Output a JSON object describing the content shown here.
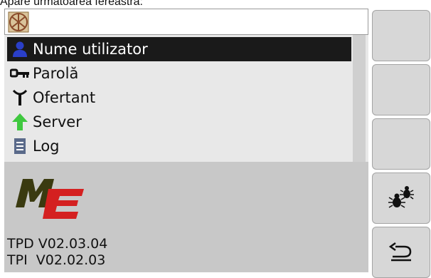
{
  "caption": "Apare următoarea fereastră:",
  "menu": {
    "items": [
      {
        "label": "Nume utilizator",
        "icon": "user-icon",
        "selected": true
      },
      {
        "label": "Parolă",
        "icon": "key-icon",
        "selected": false
      },
      {
        "label": "Ofertant",
        "icon": "antenna-icon",
        "selected": false
      },
      {
        "label": "Server",
        "icon": "up-arrow-icon",
        "selected": false
      },
      {
        "label": "Log",
        "icon": "log-file-icon",
        "selected": false
      }
    ]
  },
  "info": {
    "logo_text": "ME",
    "versions": [
      "TPD V02.03.04",
      "TPI  V02.02.03"
    ]
  },
  "softkeys": [
    {
      "name": "softkey-1",
      "icon": ""
    },
    {
      "name": "softkey-2",
      "icon": ""
    },
    {
      "name": "softkey-3",
      "icon": ""
    },
    {
      "name": "bugs-diagnostics-button",
      "icon": "bugs-icon"
    },
    {
      "name": "back-button",
      "icon": "return-arrow-icon"
    }
  ],
  "colors": {
    "selection": "#1a1a1a",
    "menu_bg": "#e8e8e8",
    "info_bg": "#c8c8c8",
    "logo_green": "#3a3a10",
    "logo_red": "#d42020"
  }
}
